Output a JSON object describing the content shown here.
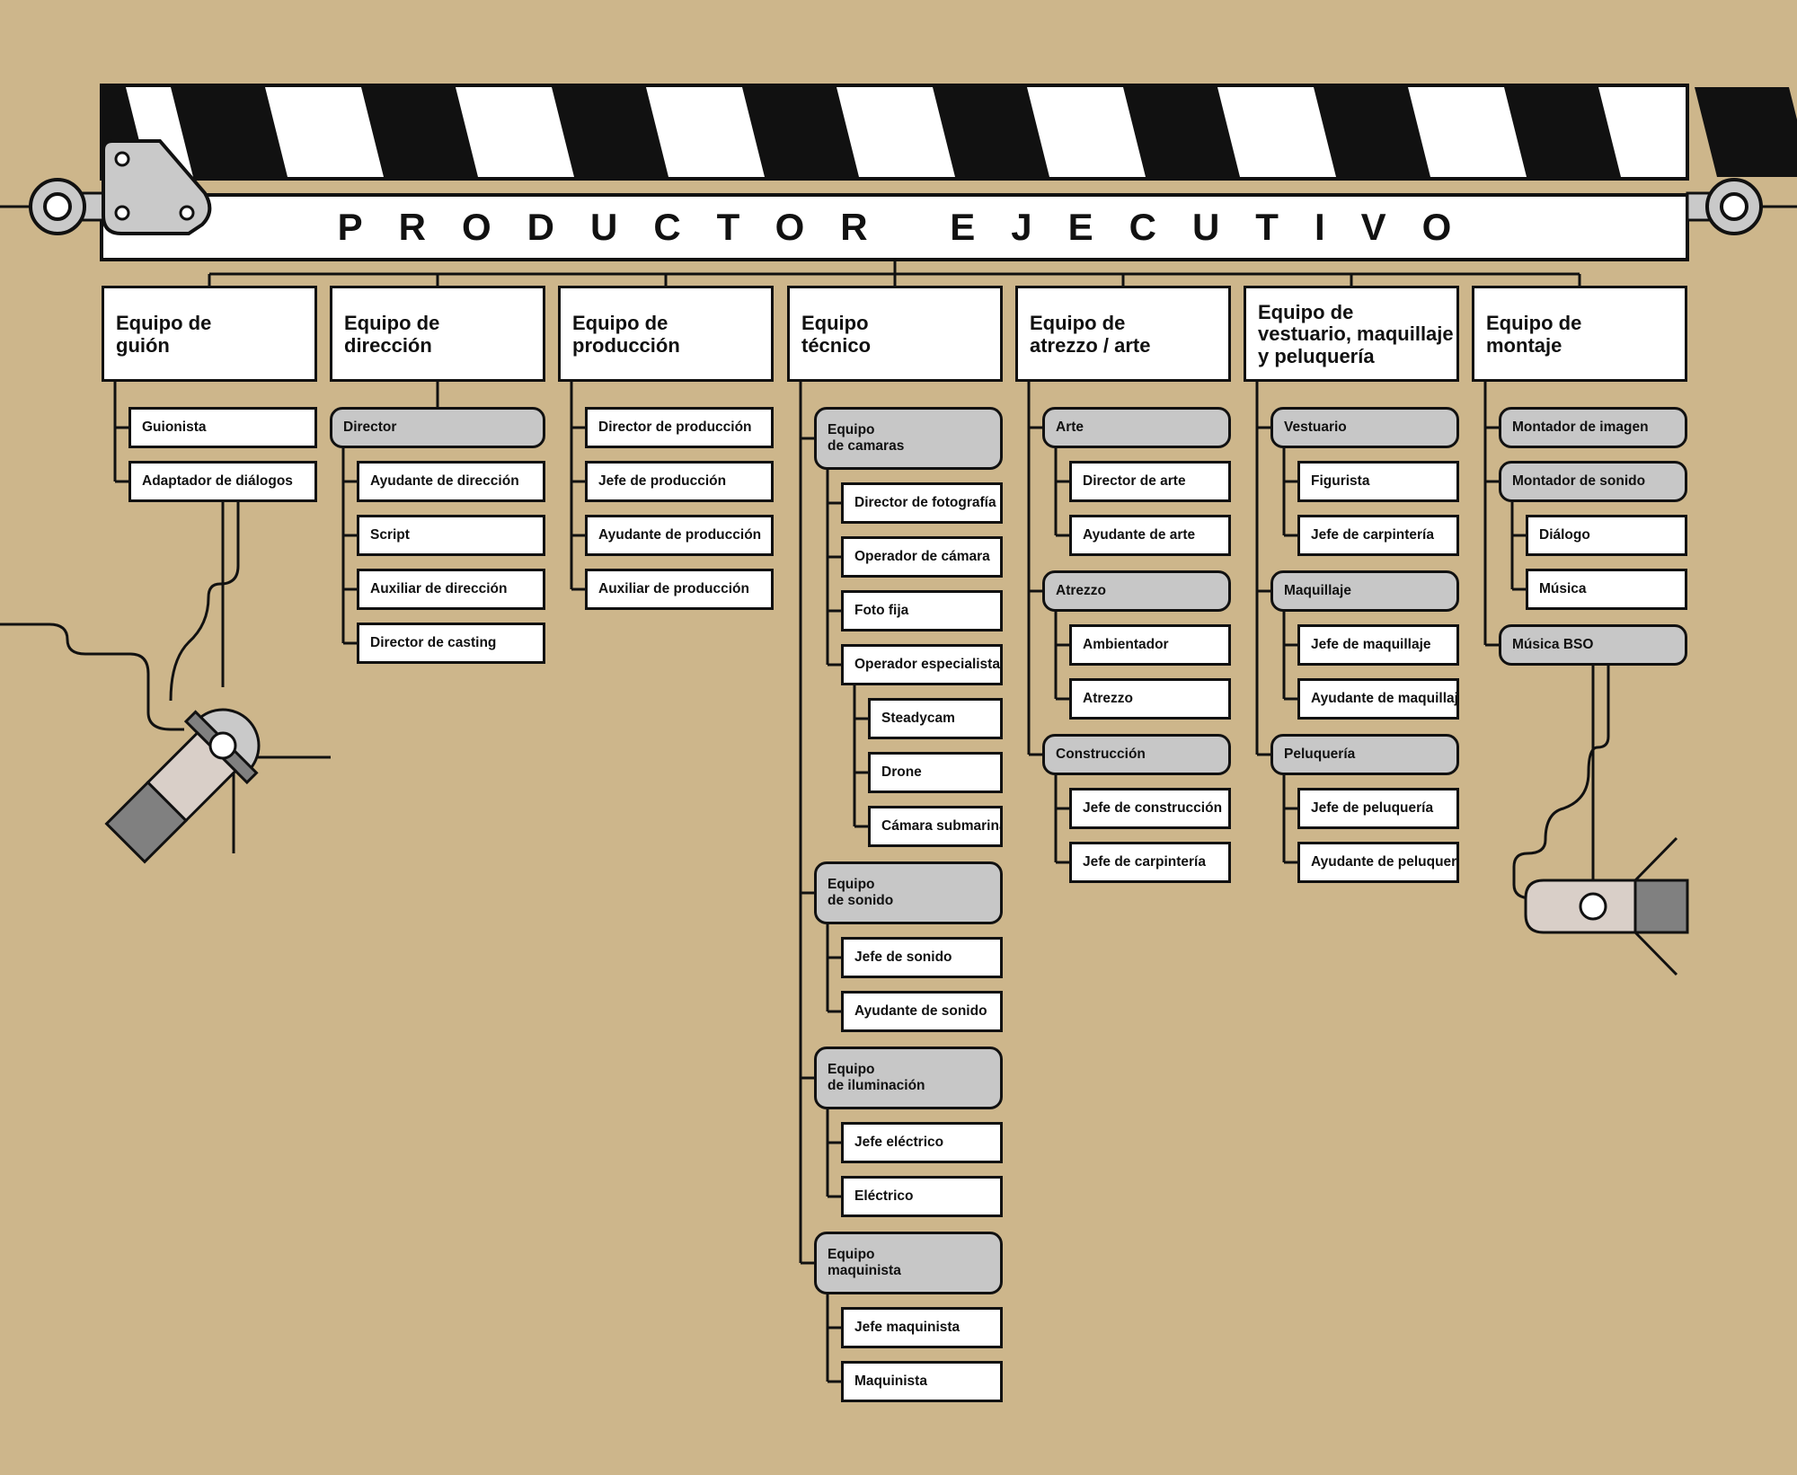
{
  "title": "PRODUCTOR EJECUTIVO",
  "colors": {
    "background": "#cdb68b",
    "box": "#ffffff",
    "subgroup": "#c7c7c7",
    "line": "#111111",
    "metal": "#c9c9c9",
    "dark": "#808080"
  },
  "icons": [
    "clapperboard-icon",
    "film-light-left-icon",
    "film-light-right-icon"
  ],
  "teams": [
    {
      "name": "Equipo de\nguión",
      "items": [
        {
          "label": "Guionista"
        },
        {
          "label": "Adaptador de diálogos"
        }
      ]
    },
    {
      "name": "Equipo de\ndirección",
      "items": [
        {
          "label": "Director",
          "children": [
            {
              "label": "Ayudante de dirección"
            },
            {
              "label": "Script"
            },
            {
              "label": "Auxiliar de dirección"
            },
            {
              "label": "Director de casting"
            }
          ]
        }
      ]
    },
    {
      "name": "Equipo de\nproducción",
      "items": [
        {
          "label": "Director de producción"
        },
        {
          "label": "Jefe de producción"
        },
        {
          "label": "Ayudante de producción"
        },
        {
          "label": "Auxiliar de producción"
        }
      ]
    },
    {
      "name": "Equipo\ntécnico",
      "items": [
        {
          "label": "Equipo\nde camaras",
          "children": [
            {
              "label": "Director de fotografía"
            },
            {
              "label": "Operador de cámara"
            },
            {
              "label": "Foto fija"
            },
            {
              "label": "Operador especialista",
              "children": [
                {
                  "label": "Steadycam"
                },
                {
                  "label": "Drone"
                },
                {
                  "label": "Cámara submarina"
                }
              ]
            }
          ]
        },
        {
          "label": "Equipo\nde sonido",
          "children": [
            {
              "label": "Jefe de sonido"
            },
            {
              "label": "Ayudante de sonido"
            }
          ]
        },
        {
          "label": "Equipo\nde iluminación",
          "children": [
            {
              "label": "Jefe eléctrico"
            },
            {
              "label": "Eléctrico"
            }
          ]
        },
        {
          "label": "Equipo\nmaquinista",
          "children": [
            {
              "label": "Jefe maquinista"
            },
            {
              "label": "Maquinista"
            }
          ]
        }
      ]
    },
    {
      "name": "Equipo de\natrezzo / arte",
      "items": [
        {
          "label": "Arte",
          "children": [
            {
              "label": "Director de arte"
            },
            {
              "label": "Ayudante de arte"
            }
          ]
        },
        {
          "label": "Atrezzo",
          "children": [
            {
              "label": "Ambientador"
            },
            {
              "label": "Atrezzo"
            }
          ]
        },
        {
          "label": "Construcción",
          "children": [
            {
              "label": "Jefe de construcción"
            },
            {
              "label": "Jefe de carpintería"
            }
          ]
        }
      ]
    },
    {
      "name": "Equipo de\nvestuario, maquillaje\ny peluquería",
      "items": [
        {
          "label": "Vestuario",
          "children": [
            {
              "label": "Figurista"
            },
            {
              "label": "Jefe de carpintería"
            }
          ]
        },
        {
          "label": "Maquillaje",
          "children": [
            {
              "label": "Jefe de maquillaje"
            },
            {
              "label": "Ayudante de maquillaje"
            }
          ]
        },
        {
          "label": "Peluquería",
          "children": [
            {
              "label": "Jefe de peluquería"
            },
            {
              "label": "Ayudante de peluquería"
            }
          ]
        }
      ]
    },
    {
      "name": "Equipo de\nmontaje",
      "items": [
        {
          "label": "Montador de imagen",
          "children": []
        },
        {
          "label": "Montador de sonido",
          "children": [
            {
              "label": "Diálogo"
            },
            {
              "label": "Música"
            }
          ]
        },
        {
          "label": "Música BSO",
          "children": []
        }
      ]
    }
  ]
}
